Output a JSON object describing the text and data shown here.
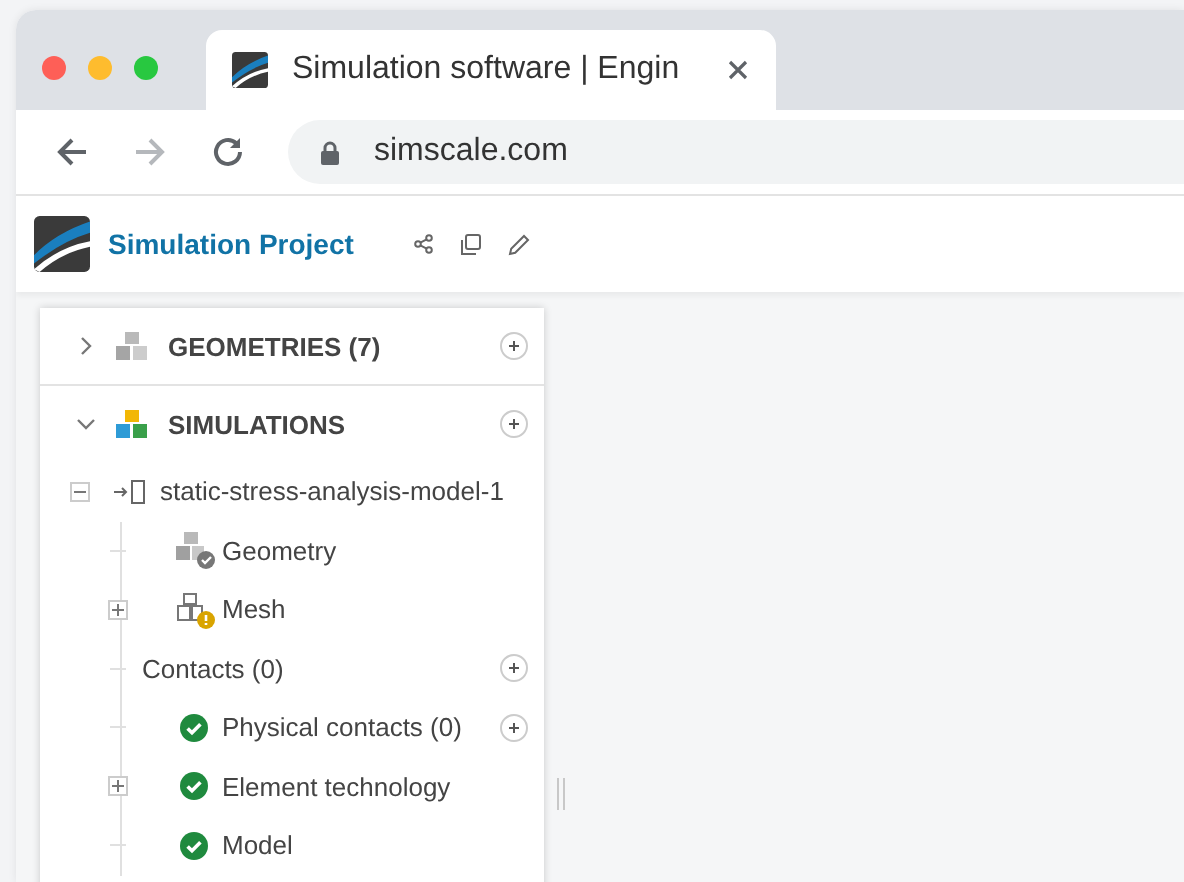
{
  "browser": {
    "tab": {
      "title": "Simulation software | Engin",
      "selected": true
    },
    "back": {
      "disabled": false
    },
    "forward": {
      "disabled": true
    },
    "url": "simscale.com"
  },
  "app": {
    "title": "Simulation Project"
  },
  "sections": [
    {
      "label": "GEOMETRIES (7)",
      "expanded": false,
      "kind": "geometries"
    },
    {
      "label": "SIMULATIONS",
      "expanded": true,
      "kind": "simulations"
    }
  ],
  "simulation": {
    "label": "static-stress-analysis-model-1",
    "expanded": true,
    "children": [
      {
        "label": "Geometry",
        "kind": "geometry",
        "expandable": false,
        "addable": false
      },
      {
        "label": "Mesh",
        "kind": "mesh",
        "expandable": true,
        "addable": false
      },
      {
        "label": "Contacts (0)",
        "kind": "group",
        "expandable": false,
        "addable": true
      },
      {
        "label": "Physical contacts (0)",
        "kind": "done",
        "expandable": false,
        "addable": true
      },
      {
        "label": "Element technology",
        "kind": "done",
        "expandable": true,
        "addable": false
      },
      {
        "label": "Model",
        "kind": "done",
        "expandable": false,
        "addable": false
      }
    ]
  }
}
